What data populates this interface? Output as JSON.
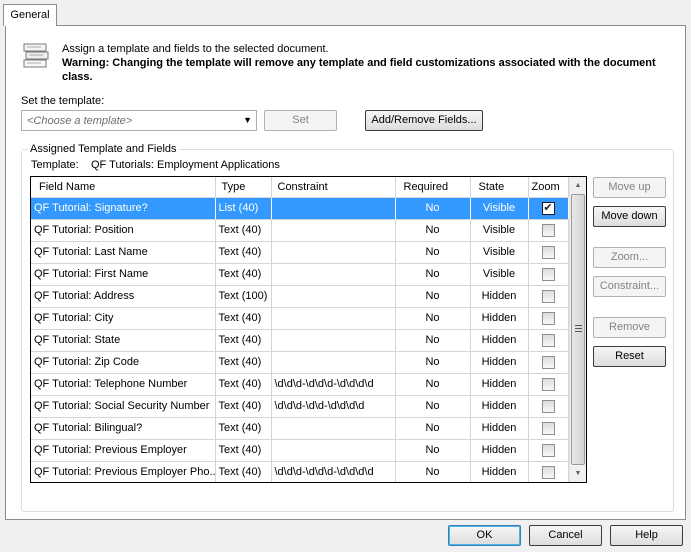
{
  "tabs": [
    {
      "label": "General"
    }
  ],
  "info": {
    "line1": "Assign a template and fields to the selected document.",
    "warning": "Warning:  Changing the template will remove any template and field customizations associated with the document class."
  },
  "template_select": {
    "label": "Set the template:",
    "placeholder": "<Choose a template>",
    "set_button": "Set",
    "add_remove_button": "Add/Remove Fields..."
  },
  "group": {
    "title": "Assigned Template and Fields",
    "template_label": "Template:",
    "template_value": "QF Tutorials: Employment Applications"
  },
  "grid": {
    "columns": [
      "Field Name",
      "Type",
      "Constraint",
      "Required",
      "State",
      "Zoom"
    ],
    "rows": [
      {
        "name": "QF Tutorial: Signature?",
        "type": "List (40)",
        "constraint": "",
        "required": "No",
        "state": "Visible",
        "zoom": true,
        "selected": true
      },
      {
        "name": "QF Tutorial: Position",
        "type": "Text (40)",
        "constraint": "",
        "required": "No",
        "state": "Visible",
        "zoom": false
      },
      {
        "name": "QF Tutorial: Last Name",
        "type": "Text (40)",
        "constraint": "",
        "required": "No",
        "state": "Visible",
        "zoom": false
      },
      {
        "name": "QF Tutorial: First Name",
        "type": "Text (40)",
        "constraint": "",
        "required": "No",
        "state": "Visible",
        "zoom": false
      },
      {
        "name": "QF Tutorial: Address",
        "type": "Text (100)",
        "constraint": "",
        "required": "No",
        "state": "Hidden",
        "zoom": false
      },
      {
        "name": "QF Tutorial: City",
        "type": "Text (40)",
        "constraint": "",
        "required": "No",
        "state": "Hidden",
        "zoom": false
      },
      {
        "name": "QF Tutorial: State",
        "type": "Text (40)",
        "constraint": "",
        "required": "No",
        "state": "Hidden",
        "zoom": false
      },
      {
        "name": "QF Tutorial: Zip Code",
        "type": "Text (40)",
        "constraint": "",
        "required": "No",
        "state": "Hidden",
        "zoom": false
      },
      {
        "name": "QF Tutorial: Telephone Number",
        "type": "Text (40)",
        "constraint": "\\d\\d\\d-\\d\\d\\d-\\d\\d\\d\\d",
        "required": "No",
        "state": "Hidden",
        "zoom": false
      },
      {
        "name": "QF Tutorial: Social Security Number",
        "type": "Text (40)",
        "constraint": "\\d\\d\\d-\\d\\d-\\d\\d\\d\\d",
        "required": "No",
        "state": "Hidden",
        "zoom": false
      },
      {
        "name": "QF Tutorial: Bilingual?",
        "type": "Text (40)",
        "constraint": "",
        "required": "No",
        "state": "Hidden",
        "zoom": false
      },
      {
        "name": "QF Tutorial: Previous Employer",
        "type": "Text (40)",
        "constraint": "",
        "required": "No",
        "state": "Hidden",
        "zoom": false
      },
      {
        "name": "QF Tutorial: Previous Employer Pho...",
        "type": "Text (40)",
        "constraint": "\\d\\d\\d-\\d\\d\\d-\\d\\d\\d\\d",
        "required": "No",
        "state": "Hidden",
        "zoom": false
      }
    ]
  },
  "side_buttons": {
    "move_up": "Move up",
    "move_down": "Move down",
    "zoom": "Zoom...",
    "constraint": "Constraint...",
    "remove": "Remove",
    "reset": "Reset"
  },
  "footer": {
    "ok": "OK",
    "cancel": "Cancel",
    "help": "Help"
  },
  "colors": {
    "selection": "#3399ff",
    "default_button_border": "#3c7fb1"
  }
}
